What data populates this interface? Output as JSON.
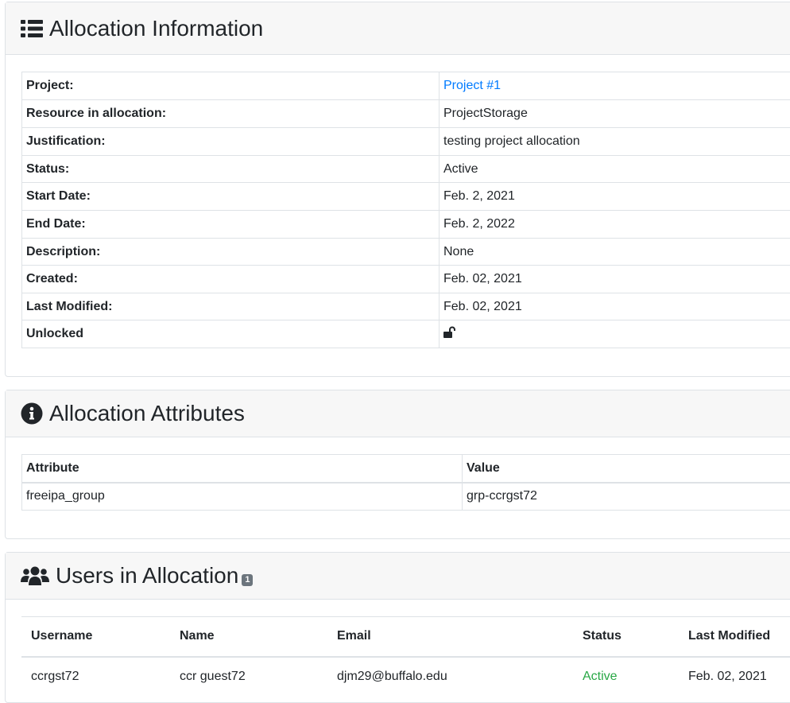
{
  "allocation_info": {
    "title": "Allocation Information",
    "rows": [
      {
        "label": "Project:",
        "value": "Project #1",
        "is_link": true
      },
      {
        "label": "Resource in allocation:",
        "value": "ProjectStorage"
      },
      {
        "label": "Justification:",
        "value": "testing project allocation"
      },
      {
        "label": "Status:",
        "value": "Active"
      },
      {
        "label": "Start Date:",
        "value": "Feb. 2, 2021"
      },
      {
        "label": "End Date:",
        "value": "Feb. 2, 2022"
      },
      {
        "label": "Description:",
        "value": "None"
      },
      {
        "label": "Created:",
        "value": "Feb. 02, 2021"
      },
      {
        "label": "Last Modified:",
        "value": "Feb. 02, 2021"
      },
      {
        "label": "Unlocked",
        "value_icon": "unlock-icon"
      }
    ]
  },
  "attributes": {
    "title": "Allocation Attributes",
    "headers": [
      "Attribute",
      "Value"
    ],
    "rows": [
      [
        "freeipa_group",
        "grp-ccrgst72"
      ]
    ]
  },
  "users": {
    "title": "Users in Allocation",
    "badge": "1",
    "headers": [
      "Username",
      "Name",
      "Email",
      "Status",
      "Last Modified"
    ],
    "rows": [
      {
        "username": "ccrgst72",
        "name": "ccr guest72",
        "email": "djm29@buffalo.edu",
        "status": "Active",
        "last_modified": "Feb. 02, 2021"
      }
    ]
  },
  "colors": {
    "link": "#007bff",
    "status_active": "#28a745",
    "badge": "#6c757d",
    "header_bg": "#f7f7f7"
  }
}
